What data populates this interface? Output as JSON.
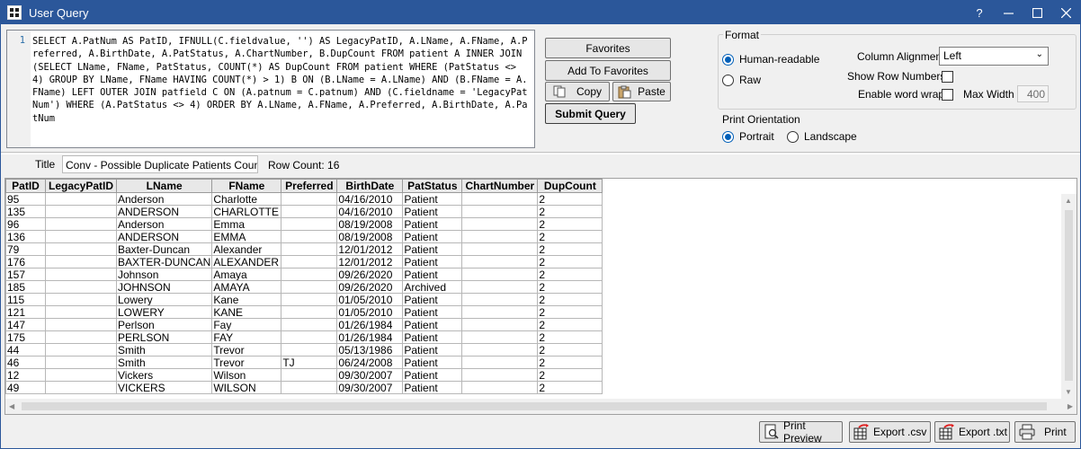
{
  "window": {
    "title": "User Query",
    "help": "?"
  },
  "query": {
    "line_number": "1",
    "text": "SELECT A.PatNum AS PatID, IFNULL(C.fieldvalue, '') AS LegacyPatID, A.LName, A.FName, A.Preferred, A.BirthDate, A.PatStatus, A.ChartNumber, B.DupCount FROM patient A INNER JOIN (SELECT LName, FName, PatStatus, COUNT(*) AS DupCount FROM patient WHERE (PatStatus <> 4) GROUP BY LName, FName HAVING COUNT(*) > 1) B ON (B.LName = A.LName) AND (B.FName = A.FName) LEFT OUTER JOIN patfield C ON (A.patnum = C.patnum) AND (C.fieldname = 'LegacyPatNum') WHERE (A.PatStatus <> 4) ORDER BY A.LName, A.FName, A.Preferred, A.BirthDate, A.PatNum"
  },
  "buttons": {
    "favorites": "Favorites",
    "add_to_favorites": "Add To Favorites",
    "copy": "Copy",
    "paste": "Paste",
    "submit_query": "Submit Query"
  },
  "format": {
    "legend": "Format",
    "human_readable": "Human-readable",
    "raw": "Raw",
    "selected": "Human-readable",
    "column_alignment_label": "Column Alignment",
    "column_alignment_value": "Left",
    "show_row_numbers": "Show Row Numbers",
    "enable_word_wrap": "Enable word wrap",
    "max_width_label": "Max Width",
    "max_width_value": "400"
  },
  "print_orientation": {
    "label": "Print Orientation",
    "portrait": "Portrait",
    "landscape": "Landscape",
    "selected": "Portrait"
  },
  "results": {
    "title_label": "Title",
    "title_value": "Conv - Possible Duplicate Patients Count",
    "row_count": "Row Count: 16",
    "columns": [
      "PatID",
      "LegacyPatID",
      "LName",
      "FName",
      "Preferred",
      "BirthDate",
      "PatStatus",
      "ChartNumber",
      "DupCount"
    ],
    "rows": [
      [
        "95",
        "",
        "Anderson",
        "Charlotte",
        "",
        "04/16/2010",
        "Patient",
        "",
        "2"
      ],
      [
        "135",
        "",
        "ANDERSON",
        "CHARLOTTE",
        "",
        "04/16/2010",
        "Patient",
        "",
        "2"
      ],
      [
        "96",
        "",
        "Anderson",
        "Emma",
        "",
        "08/19/2008",
        "Patient",
        "",
        "2"
      ],
      [
        "136",
        "",
        "ANDERSON",
        "EMMA",
        "",
        "08/19/2008",
        "Patient",
        "",
        "2"
      ],
      [
        "79",
        "",
        "Baxter-Duncan",
        "Alexander",
        "",
        "12/01/2012",
        "Patient",
        "",
        "2"
      ],
      [
        "176",
        "",
        "BAXTER-DUNCAN",
        "ALEXANDER",
        "",
        "12/01/2012",
        "Patient",
        "",
        "2"
      ],
      [
        "157",
        "",
        "Johnson",
        "Amaya",
        "",
        "09/26/2020",
        "Patient",
        "",
        "2"
      ],
      [
        "185",
        "",
        "JOHNSON",
        "AMAYA",
        "",
        "09/26/2020",
        "Archived",
        "",
        "2"
      ],
      [
        "115",
        "",
        "Lowery",
        "Kane",
        "",
        "01/05/2010",
        "Patient",
        "",
        "2"
      ],
      [
        "121",
        "",
        "LOWERY",
        "KANE",
        "",
        "01/05/2010",
        "Patient",
        "",
        "2"
      ],
      [
        "147",
        "",
        "Perlson",
        "Fay",
        "",
        "01/26/1984",
        "Patient",
        "",
        "2"
      ],
      [
        "175",
        "",
        "PERLSON",
        "FAY",
        "",
        "01/26/1984",
        "Patient",
        "",
        "2"
      ],
      [
        "44",
        "",
        "Smith",
        "Trevor",
        "",
        "05/13/1986",
        "Patient",
        "",
        "2"
      ],
      [
        "46",
        "",
        "Smith",
        "Trevor",
        "TJ",
        "06/24/2008",
        "Patient",
        "",
        "2"
      ],
      [
        "12",
        "",
        "Vickers",
        "Wilson",
        "",
        "09/30/2007",
        "Patient",
        "",
        "2"
      ],
      [
        "49",
        "",
        "VICKERS",
        "WILSON",
        "",
        "09/30/2007",
        "Patient",
        "",
        "2"
      ]
    ]
  },
  "footer": {
    "print_preview": "Print Preview",
    "export_csv": "Export .csv",
    "export_txt": "Export .txt",
    "print": "Print"
  },
  "colors": {
    "titlebar": "#2b579a",
    "radio_accent": "#005fb8",
    "export_arrow": "#e02020"
  }
}
